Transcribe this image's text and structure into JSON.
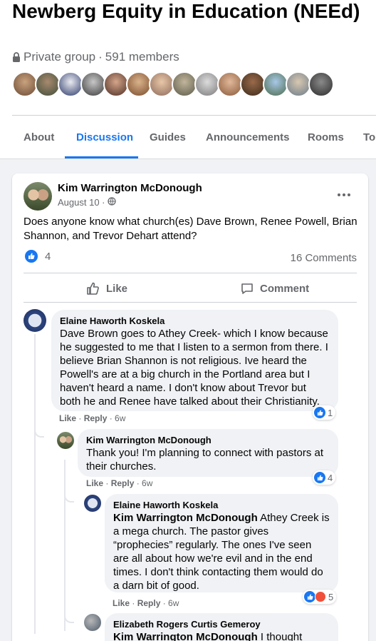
{
  "group": {
    "title": "Newberg Equity in Education (NEEd)",
    "privacy": "Private group",
    "separator": "·",
    "members": "591 members"
  },
  "tabs": [
    {
      "label": "About"
    },
    {
      "label": "Discussion"
    },
    {
      "label": "Guides"
    },
    {
      "label": "Announcements"
    },
    {
      "label": "Rooms"
    },
    {
      "label": "Top"
    }
  ],
  "post": {
    "author": "Kim Warrington McDonough",
    "date": "August 10 ·",
    "audience_icon": "globe-icon",
    "body": "Does anyone know what church(es) Dave Brown, Renee Powell, Brian Shannon, and Trevor Dehart attend?",
    "like_count": "4",
    "comments_count": "16 Comments",
    "like_label": "Like",
    "comment_label": "Comment"
  },
  "comments": [
    {
      "author": "Elaine Haworth Koskela",
      "text": "Dave Brown goes to Athey Creek- which I know because he suggested to me that I listen to a sermon from there. I believe Brian Shannon is not religious. Ive heard the Powell's are at a big church in the Portland area but I haven't heard a name. I don't know about Trevor but both he and Renee have talked about their Christianity.",
      "like": "Like",
      "reply": "Reply",
      "time": "6w",
      "reactions": "1"
    },
    {
      "author": "Kim Warrington McDonough",
      "text": "Thank you! I'm planning to connect with pastors at their churches.",
      "like": "Like",
      "reply": "Reply",
      "time": "6w",
      "reactions": "4"
    },
    {
      "author": "Elaine Haworth Koskela",
      "mention": "Kim Warrington McDonough",
      "text": " Athey Creek is a mega church. The pastor gives “prophecies” regularly. The ones I've seen are all about how we're evil and in the end times. I don't think contacting them would do a darn bit of good.",
      "like": "Like",
      "reply": "Reply",
      "time": "6w",
      "reactions": "5"
    },
    {
      "author": "Elizabeth Rogers Curtis Gemeroy",
      "mention": "Kim Warrington McDonough",
      "text": " I thought"
    }
  ],
  "colors": {
    "accent": "#1877f2",
    "secondary_text": "#65676b",
    "angry": "#f0503a"
  }
}
